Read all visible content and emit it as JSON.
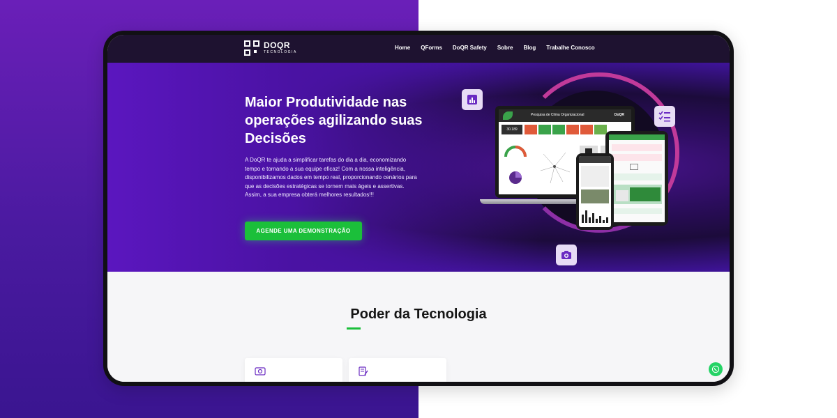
{
  "brand": {
    "name": "DOQR",
    "subtitle": "TECNOLOGIA"
  },
  "nav": {
    "items": [
      {
        "label": "Home"
      },
      {
        "label": "QForms"
      },
      {
        "label": "DoQR Safety"
      },
      {
        "label": "Sobre"
      },
      {
        "label": "Blog"
      },
      {
        "label": "Trabalhe Conosco"
      }
    ]
  },
  "hero": {
    "title": "Maior Produtividade nas operações agilizando suas Decisões",
    "description": "A DoQR te ajuda a simplificar tarefas do dia a dia, economizando tempo e tornando a sua equipe eficaz! Com a nossa inteligência, disponibilizamos dados em tempo real, proporcionando cenários para que as decisões estratégicas se tornem mais ágeis e assertivas. Assim, a sua empresa obterá melhores resultados!!!",
    "cta_label": "AGENDE UMA DEMONSTRAÇÃO"
  },
  "dashboard": {
    "header_text": "Pesquisa de Clima Organizacional",
    "brand": "DoQR",
    "kpi_value": "30.189"
  },
  "section": {
    "title": "Poder da Tecnologia"
  },
  "icons": {
    "chart": "bar-chart-icon",
    "checklist": "checklist-icon",
    "camera": "camera-icon",
    "whatsapp": "whatsapp-icon",
    "card1": "money-icon",
    "card2": "document-edit-icon"
  },
  "colors": {
    "accent_green": "#1bbf3a",
    "hero_purple": "#5a17c2",
    "nav_dark": "#1e1230",
    "ring_pink": "#c13a9a"
  }
}
